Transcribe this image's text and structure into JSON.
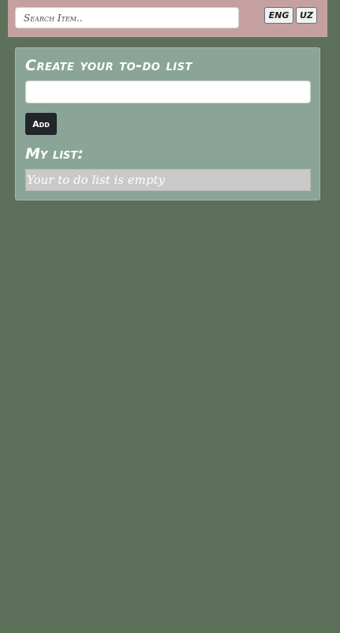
{
  "header": {
    "search": {
      "placeholder": "Search Item..",
      "value": ""
    },
    "languages": [
      {
        "label": "ENG"
      },
      {
        "label": "UZ"
      }
    ]
  },
  "todo": {
    "title": "Create your to-do list",
    "input_value": "",
    "add_label": "Add",
    "list_title": "My list:",
    "empty_message": "Your to do list is empty"
  },
  "colors": {
    "background": "#5d705a",
    "header": "#c5a0a1",
    "card": "#8aa597",
    "add_button": "#22252a",
    "empty_box": "#c9c9c9"
  }
}
